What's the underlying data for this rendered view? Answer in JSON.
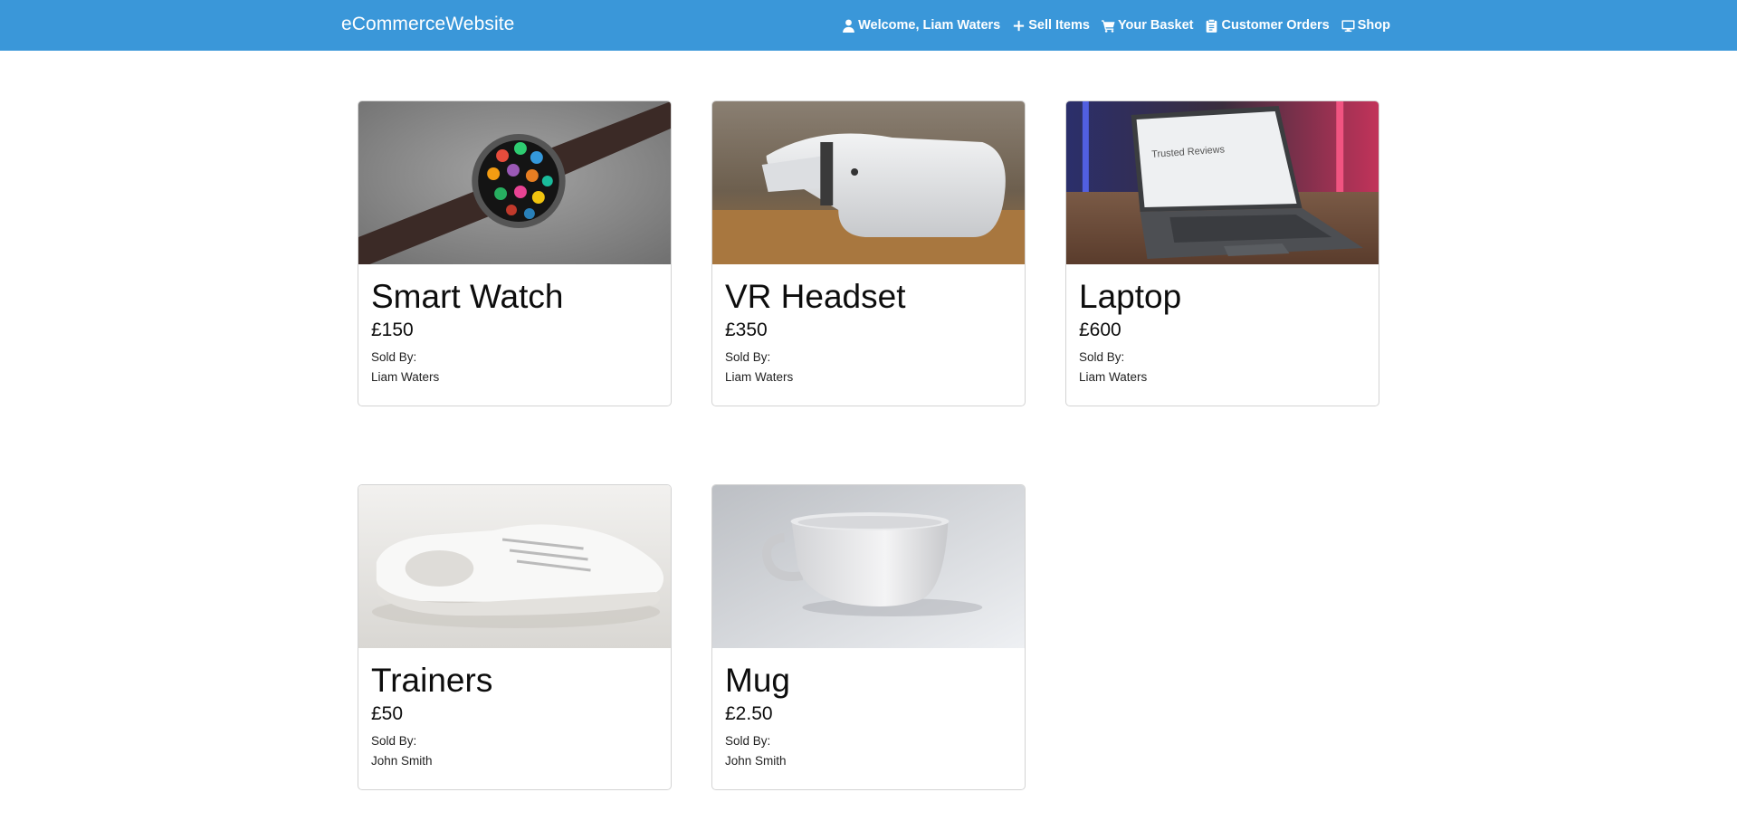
{
  "navbar": {
    "brand": "eCommerceWebsite",
    "links": [
      {
        "label": "Welcome, Liam Waters",
        "icon": "user-icon"
      },
      {
        "label": "Sell Items",
        "icon": "plus-icon"
      },
      {
        "label": "Your Basket",
        "icon": "cart-icon"
      },
      {
        "label": "Customer Orders",
        "icon": "clipboard-icon"
      },
      {
        "label": "Shop",
        "icon": "monitor-icon"
      }
    ],
    "background": "#3a97d9"
  },
  "products": [
    {
      "name": "Smart Watch",
      "price": "£150",
      "sold_by_label": "Sold By:",
      "seller": "Liam Waters",
      "image": "smart-watch-photo"
    },
    {
      "name": "VR Headset",
      "price": "£350",
      "sold_by_label": "Sold By:",
      "seller": "Liam Waters",
      "image": "vr-headset-photo"
    },
    {
      "name": "Laptop",
      "price": "£600",
      "sold_by_label": "Sold By:",
      "seller": "Liam Waters",
      "image": "laptop-photo",
      "image_text": "Trusted Reviews"
    },
    {
      "name": "Trainers",
      "price": "£50",
      "sold_by_label": "Sold By:",
      "seller": "John Smith",
      "image": "trainers-photo"
    },
    {
      "name": "Mug",
      "price": "£2.50",
      "sold_by_label": "Sold By:",
      "seller": "John Smith",
      "image": "mug-photo"
    }
  ]
}
